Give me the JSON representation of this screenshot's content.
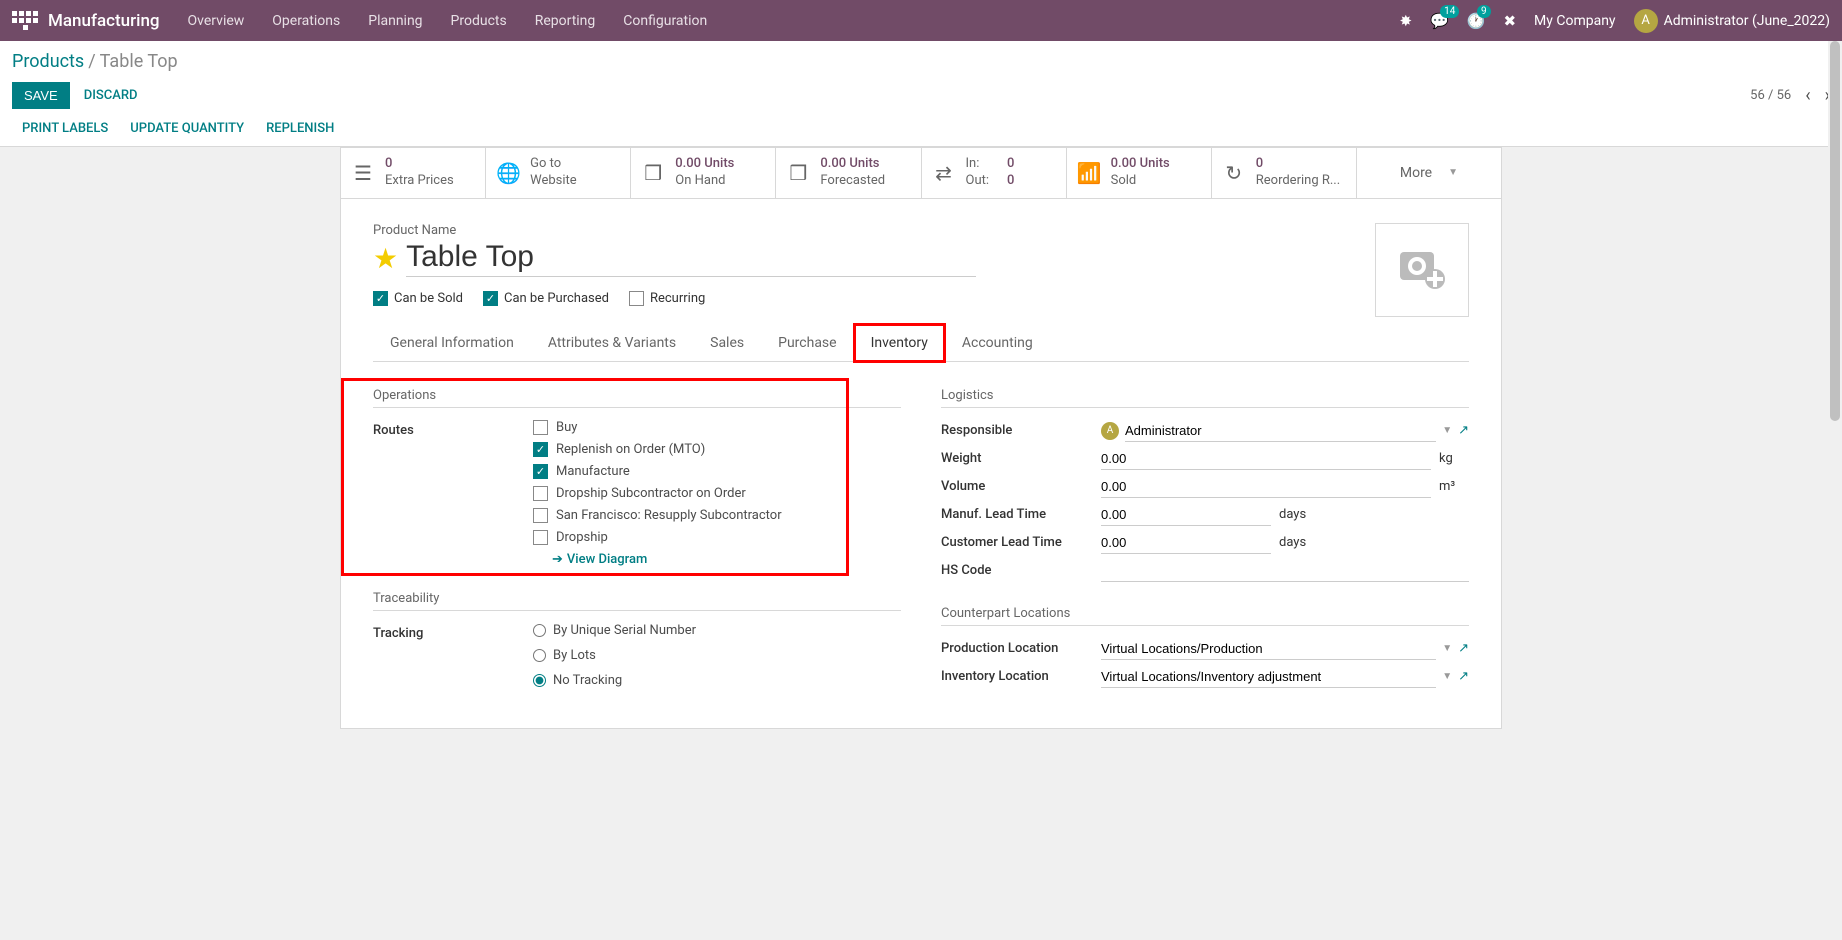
{
  "topnav": {
    "brand": "Manufacturing",
    "menu": [
      "Overview",
      "Operations",
      "Planning",
      "Products",
      "Reporting",
      "Configuration"
    ],
    "msg_badge": "14",
    "activity_badge": "9",
    "company": "My Company",
    "avatar_letter": "A",
    "user": "Administrator (June_2022)"
  },
  "breadcrumb": {
    "root": "Products",
    "current": "Table Top"
  },
  "buttons": {
    "save": "SAVE",
    "discard": "DISCARD"
  },
  "pager": "56 / 56",
  "actions": [
    "PRINT LABELS",
    "UPDATE QUANTITY",
    "REPLENISH"
  ],
  "statboxes": {
    "extra": {
      "top": "0",
      "bottom": "Extra Prices"
    },
    "website": {
      "top": "Go to",
      "bottom": "Website"
    },
    "onhand": {
      "top": "0.00 Units",
      "bottom": "On Hand"
    },
    "forecast": {
      "top": "0.00 Units",
      "bottom": "Forecasted"
    },
    "inout": {
      "in_label": "In:",
      "in_val": "0",
      "out_label": "Out:",
      "out_val": "0"
    },
    "sold": {
      "top": "0.00 Units",
      "bottom": "Sold"
    },
    "reorder": {
      "top": "0",
      "bottom": "Reordering R..."
    },
    "more": "More"
  },
  "product": {
    "name_label": "Product Name",
    "name": "Table Top",
    "can_be_sold": "Can be Sold",
    "can_be_purchased": "Can be Purchased",
    "recurring": "Recurring"
  },
  "tabs": [
    "General Information",
    "Attributes & Variants",
    "Sales",
    "Purchase",
    "Inventory",
    "Accounting"
  ],
  "operations": {
    "title": "Operations",
    "routes_label": "Routes",
    "routes": {
      "buy": "Buy",
      "mto": "Replenish on Order (MTO)",
      "manufacture": "Manufacture",
      "dropship_sub": "Dropship Subcontractor on Order",
      "sf_resupply": "San Francisco: Resupply Subcontractor",
      "dropship": "Dropship"
    },
    "view_diagram": "View Diagram"
  },
  "traceability": {
    "title": "Traceability",
    "tracking_label": "Tracking",
    "serial": "By Unique Serial Number",
    "lots": "By Lots",
    "none": "No Tracking"
  },
  "logistics": {
    "title": "Logistics",
    "responsible_label": "Responsible",
    "responsible_value": "Administrator",
    "resp_letter": "A",
    "weight_label": "Weight",
    "weight_value": "0.00",
    "weight_unit": "kg",
    "volume_label": "Volume",
    "volume_value": "0.00",
    "volume_unit": "m³",
    "mlt_label": "Manuf. Lead Time",
    "mlt_value": "0.00",
    "mlt_unit": "days",
    "clt_label": "Customer Lead Time",
    "clt_value": "0.00",
    "clt_unit": "days",
    "hs_label": "HS Code",
    "hs_value": ""
  },
  "counterpart": {
    "title": "Counterpart Locations",
    "prod_label": "Production Location",
    "prod_value": "Virtual Locations/Production",
    "inv_label": "Inventory Location",
    "inv_value": "Virtual Locations/Inventory adjustment"
  }
}
